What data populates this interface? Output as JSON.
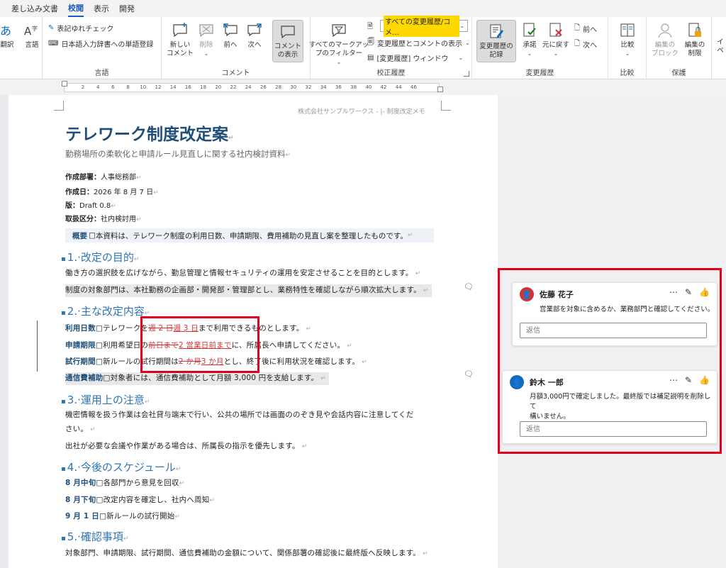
{
  "tabs": [
    "差し込み文書",
    "校閲",
    "表示",
    "開発"
  ],
  "ribbon": {
    "partial_left": {
      "translate": "翻訳",
      "language": "言語",
      "group_label": "言語"
    },
    "proofing": {
      "spelling": "表記ゆれチェック",
      "dictionary": "日本語入力辞書への単語登録"
    },
    "comments": {
      "new_comment": "新しい\nコメント",
      "delete": "削除",
      "previous": "前へ",
      "next": "次へ",
      "show_comments": "コメント\nの表示",
      "group_label": "コメント"
    },
    "tracking": {
      "all_markup_filter": "すべてのマークアッ\nプのフィルター",
      "markup_dropdown_value": "すべての変更履歴/コメ…",
      "show_markup": "変更履歴とコメントの表示",
      "reviewing_pane": "[変更履歴] ウィンドウ",
      "group_label": "校正履歴"
    },
    "changes": {
      "track_changes": "変更履歴の\n記録",
      "accept": "承諾",
      "reject": "元に戻す",
      "previous": "前へ",
      "next": "次へ",
      "group_label": "変更履歴"
    },
    "compare": {
      "compare": "比較",
      "group_label": "比較"
    },
    "protect": {
      "block_authors": "編集の\nブロック",
      "restrict_editing": "編集の\n制限",
      "group_label": "保護"
    },
    "ink": {
      "label": "イ\nペ"
    }
  },
  "ruler": [
    "2",
    "4",
    "6",
    "8",
    "10",
    "12",
    "14",
    "16",
    "18",
    "20",
    "22",
    "24",
    "26",
    "28",
    "30",
    "32",
    "34",
    "36",
    "38",
    "40",
    "42",
    "44",
    "46"
  ],
  "document": {
    "header": "株式会社サンプルワークス - |- 制度改定メモ",
    "title": "テレワーク制度改定案",
    "subtitle": "勤務場所の柔軟化と申請ルール見直しに関する社内検討資料",
    "meta": [
      {
        "label": "作成部署：",
        "value": "人事総務部"
      },
      {
        "label": "作成日：",
        "value": "2026 年 8 月 7 日"
      },
      {
        "label": "版：",
        "value": "Draft 0.8"
      },
      {
        "label": "取扱区分：",
        "value": "社内検討用"
      }
    ],
    "overview_label": "概要",
    "overview_text": "本資料は、テレワーク制度の利用日数、申請期限、費用補助の見直し案を整理したものです。",
    "sections": [
      {
        "heading": "1.·改定の目的"
      },
      {
        "heading": "2.·主な改定内容"
      },
      {
        "heading": "3.·運用上の注意"
      },
      {
        "heading": "4.·今後のスケジュール"
      },
      {
        "heading": "5.·確認事項"
      }
    ],
    "s1_p1": "働き方の選択肢を広げながら、勤怠管理と情報セキュリティの運用を安定させることを目的とします。",
    "s1_p2": "制度の対象部門は、本社勤務の企画部・開発部・管理部とし、業務特性を確認しながら順次拡大します。",
    "s2": {
      "days_label": "利用日数",
      "days_pre": "テレワークを",
      "days_del": "週 2 日",
      "days_ins": "週 3 日",
      "days_post": "まで利用できるものとします。",
      "apply_label": "申請期限",
      "apply_pre": "利用希望日の",
      "apply_del": "前日まで",
      "apply_ins": "2 営業日前まで",
      "apply_post": "に、所属長へ申請してください。",
      "trial_label": "試行期間",
      "trial_pre": "新ルールの試行期間は",
      "trial_del": "2 か月",
      "trial_ins": "3 か月",
      "trial_post": "とし、終了後に利用状況を確認します。",
      "subsidy_label": "通信費補助",
      "subsidy_text": "対象者には、通信費補助として月額 3,000 円を支給します。"
    },
    "s3_p1a": "機密情報を扱う作業は会社貸与端末で行い、公共の場所では画面ののぞき見や会話内容に注意してくだ",
    "s3_p1b": "さい。",
    "s3_p2": "出社が必要な会議や作業がある場合は、所属長の指示を優先します。",
    "s4": [
      {
        "label": "8 月中旬",
        "text": "各部門から意見を回収"
      },
      {
        "label": "8 月下旬",
        "text": "改定内容を確定し、社内へ周知"
      },
      {
        "label": "9 月 1 日",
        "text": "新ルールの試行開始"
      }
    ],
    "s5_p1": "対象部門、申請期限、試行期間、通信費補助の金額について、関係部署の確認後に最終版へ反映します。"
  },
  "comments": [
    {
      "author": "佐藤 花子",
      "avatar_color": "#d13438",
      "body": "営業部を対象に含めるか、業務部門と確認してください。",
      "reply_placeholder": "返信"
    },
    {
      "author": "鈴木 一郎",
      "avatar_color": "#0f6cbd",
      "body_line1": "月額3,000円で確定しました。最終版では補足説明を削除して",
      "body_line2": "構いません。",
      "reply_placeholder": "返信"
    }
  ]
}
